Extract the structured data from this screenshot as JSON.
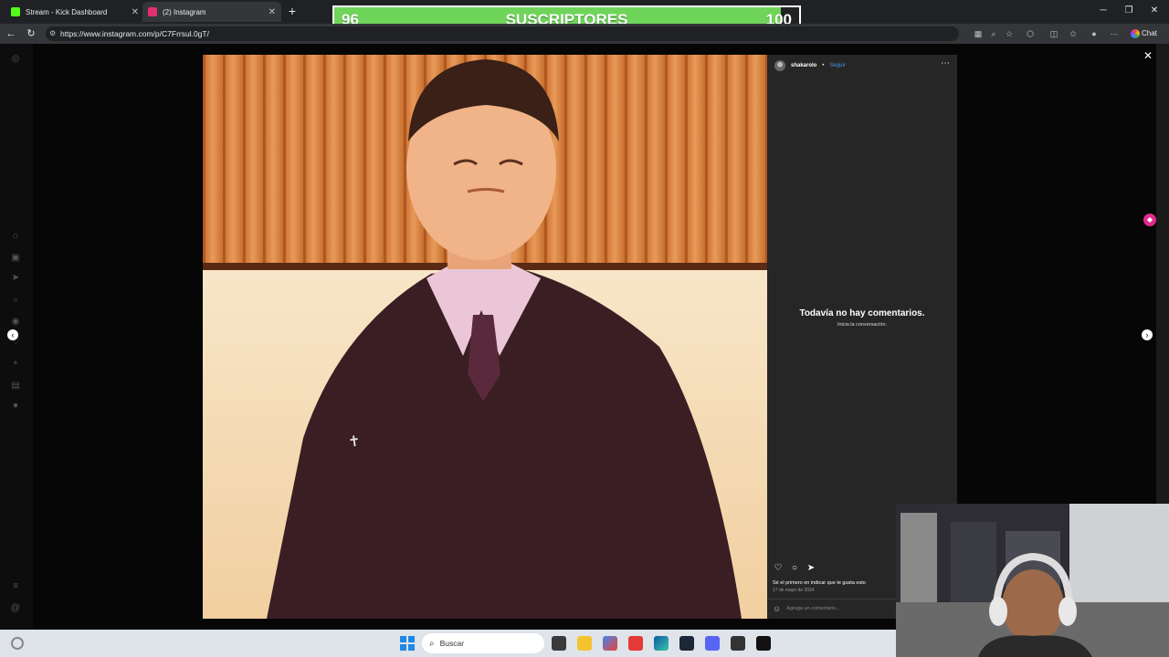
{
  "browser": {
    "tabs": [
      {
        "title": "Stream - Kick Dashboard",
        "favicon_color": "#53fc18",
        "active": false
      },
      {
        "title": "(2) Instagram",
        "favicon_color": "#e1306c",
        "active": true
      }
    ],
    "url": "https://www.instagram.com/p/C7Frrsul.0gT/",
    "chat_label": "Chat"
  },
  "overlay": {
    "current": "96",
    "label": "SUSCRIPTORES",
    "goal": "100",
    "progress": 0.96,
    "fill_color": "#6fd55a"
  },
  "post": {
    "username": "shakarolo",
    "follow_label": "Seguir",
    "separator": "•",
    "no_comments_title": "Todavía no hay comentarios.",
    "no_comments_sub": "Inicia la conversación.",
    "first_like_text": "Sé el primero en indicar que te gusta esto",
    "date": "17 de mayo de 2024",
    "comment_placeholder": "Agrega un comentario..."
  },
  "taskbar": {
    "search_label": "Buscar"
  }
}
